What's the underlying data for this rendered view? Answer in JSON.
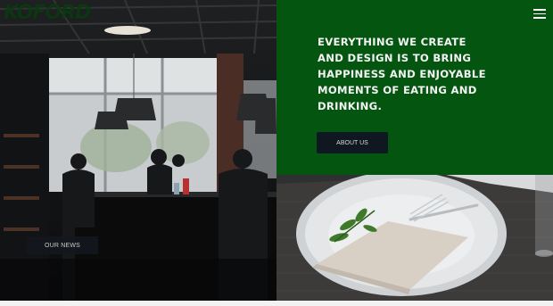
{
  "header": {
    "logo_text": "KOFORD"
  },
  "hero": {
    "headline": "EVERYTHING WE CREATE AND DESIGN IS TO BRING HAPPINESS AND ENJOYABLE MOMENTS OF EATING AND DRINKING.",
    "about_button": "ABOUT US"
  },
  "news": {
    "button": "OUR NEWS"
  },
  "colors": {
    "green": "#04550f",
    "button_dark": "#0f1720"
  }
}
